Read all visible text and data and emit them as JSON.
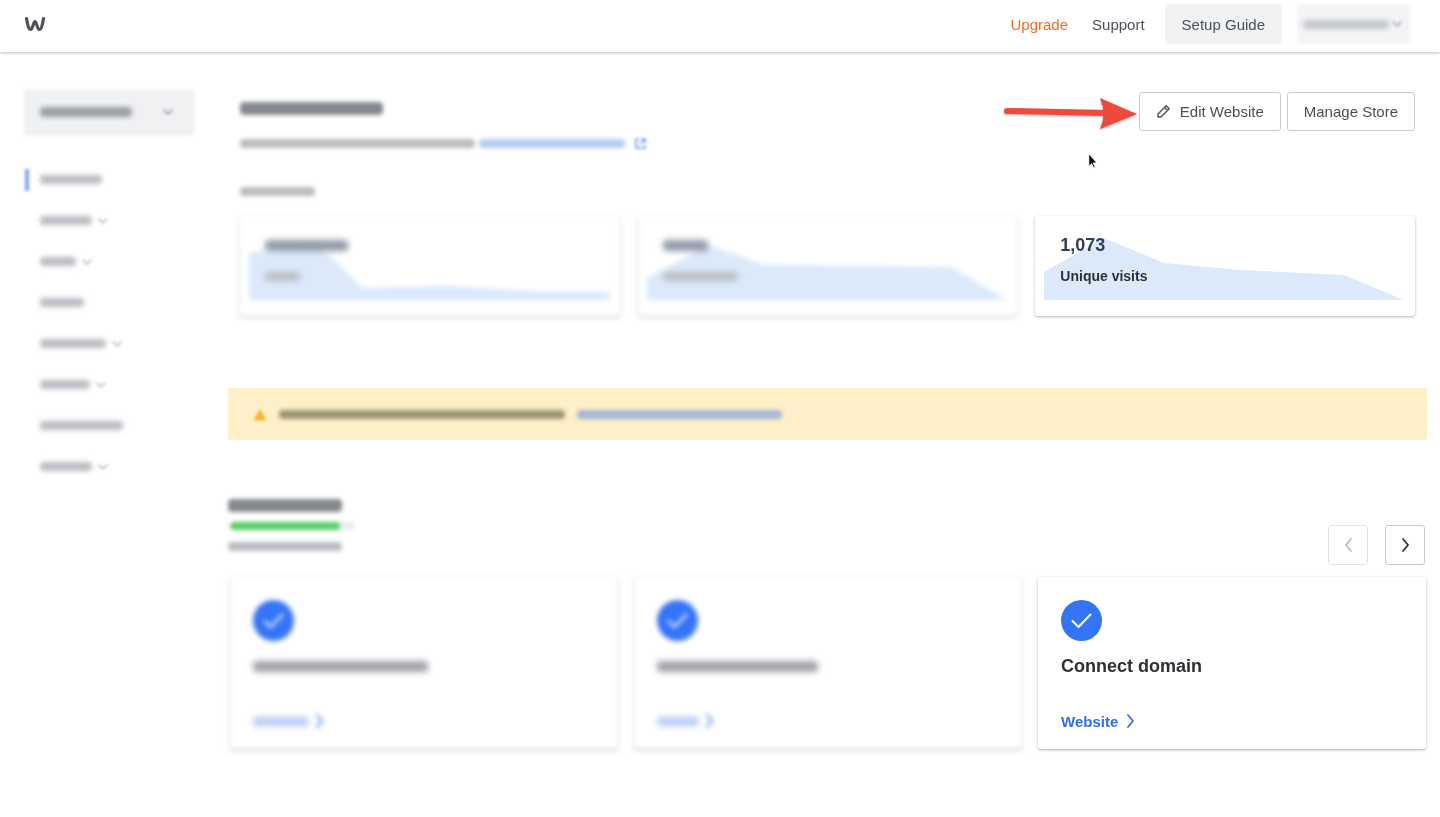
{
  "top_bar": {
    "links": [
      {
        "kind": "upgrade",
        "label": "Upgrade"
      },
      {
        "kind": "link",
        "label": "Support"
      },
      {
        "kind": "button",
        "label": "Setup Guide"
      }
    ],
    "account_menu": {
      "blurred": true
    }
  },
  "sidebar": {
    "site_menu": {
      "blurred": true
    },
    "items": [
      {
        "blurred": true,
        "caret": false,
        "selected": true
      },
      {
        "blurred": true,
        "caret": true,
        "selected": false
      },
      {
        "blurred": true,
        "caret": true,
        "selected": false
      },
      {
        "blurred": true,
        "caret": false,
        "selected": false
      },
      {
        "blurred": true,
        "caret": true,
        "selected": false
      },
      {
        "blurred": true,
        "caret": true,
        "selected": false
      },
      {
        "blurred": true,
        "caret": false,
        "selected": false
      },
      {
        "blurred": true,
        "caret": true,
        "selected": false
      }
    ]
  },
  "header": {
    "title": {
      "blurred": true
    },
    "subtitle": {
      "blurred": true
    },
    "period": {
      "blurred": true
    },
    "buttons": [
      {
        "kind": "edit",
        "label": "Edit Website"
      },
      {
        "kind": "plain",
        "label": "Manage Store"
      }
    ]
  },
  "stats": [
    {
      "blurred": true
    },
    {
      "blurred": true
    },
    {
      "blurred": false,
      "value": "1,073",
      "label": "Unique visits"
    }
  ],
  "banner": {
    "blurred": true
  },
  "setup_guides": {
    "title": {
      "blurred": true
    },
    "progress": {
      "blurred": true,
      "level": 0.88
    },
    "summary": {
      "blurred": true
    },
    "nav": [
      {
        "kind": "prev",
        "disabled": true
      },
      {
        "kind": "next",
        "disabled": false
      }
    ],
    "cards": [
      {
        "blurred": true,
        "done": true
      },
      {
        "blurred": true,
        "done": true
      },
      {
        "blurred": false,
        "done": true,
        "title": "Connect domain",
        "link": "Website"
      }
    ]
  }
}
